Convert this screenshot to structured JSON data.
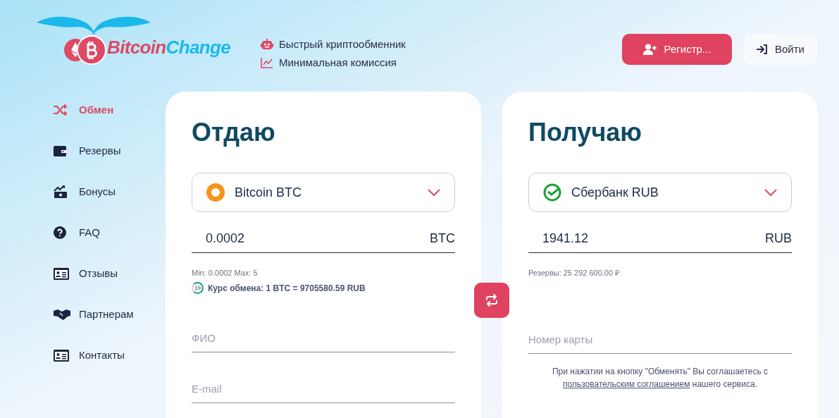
{
  "logo": {
    "part_1": "Bitcoin",
    "part_2": "Change"
  },
  "features": [
    {
      "kind": "robot",
      "text": "Быстрый криптообменник"
    },
    {
      "kind": "chart",
      "text": "Минимальная комиссия"
    }
  ],
  "header_buttons": [
    {
      "kind": "register",
      "label": "Регистр..."
    },
    {
      "kind": "login",
      "label": "Войти"
    }
  ],
  "sidebar": {
    "items": [
      {
        "kind": "shuffle",
        "label": "Обмен",
        "selected": true
      },
      {
        "kind": "wallet",
        "label": "Резервы",
        "selected": false
      },
      {
        "kind": "bonus",
        "label": "Бонусы",
        "selected": false
      },
      {
        "kind": "question",
        "label": "FAQ",
        "selected": false
      },
      {
        "kind": "card",
        "label": "Отзывы",
        "selected": false
      },
      {
        "kind": "handshake",
        "label": "Партнерам",
        "selected": false
      },
      {
        "kind": "card",
        "label": "Контакты",
        "selected": false
      }
    ]
  },
  "give": {
    "title": "Отдаю",
    "currency": "Bitcoin BTC",
    "kind": "btc",
    "amount": "0.0002",
    "unit": "BTC",
    "limits": "Min: 0.0002 Max: 5",
    "timer": "19",
    "rate": "Курс обмена: 1 BTC = 9705580.59 RUB",
    "fields": [
      {
        "placeholder": "ФИО"
      },
      {
        "placeholder": "E-mail"
      }
    ]
  },
  "receive": {
    "title": "Получаю",
    "currency": "Сбербанк RUB",
    "kind": "sber",
    "amount": "1941.12",
    "unit": "RUB",
    "reserve": "Резервы: 25 292 600.00 ₽",
    "fields": [
      {
        "placeholder": "Номер карты"
      }
    ],
    "agreement": {
      "before": "При нажатии на кнопку \"Обменять\" Вы соглашаетесь с",
      "link": "пользовательским соглашением",
      "after": "нашего сервиса."
    }
  }
}
